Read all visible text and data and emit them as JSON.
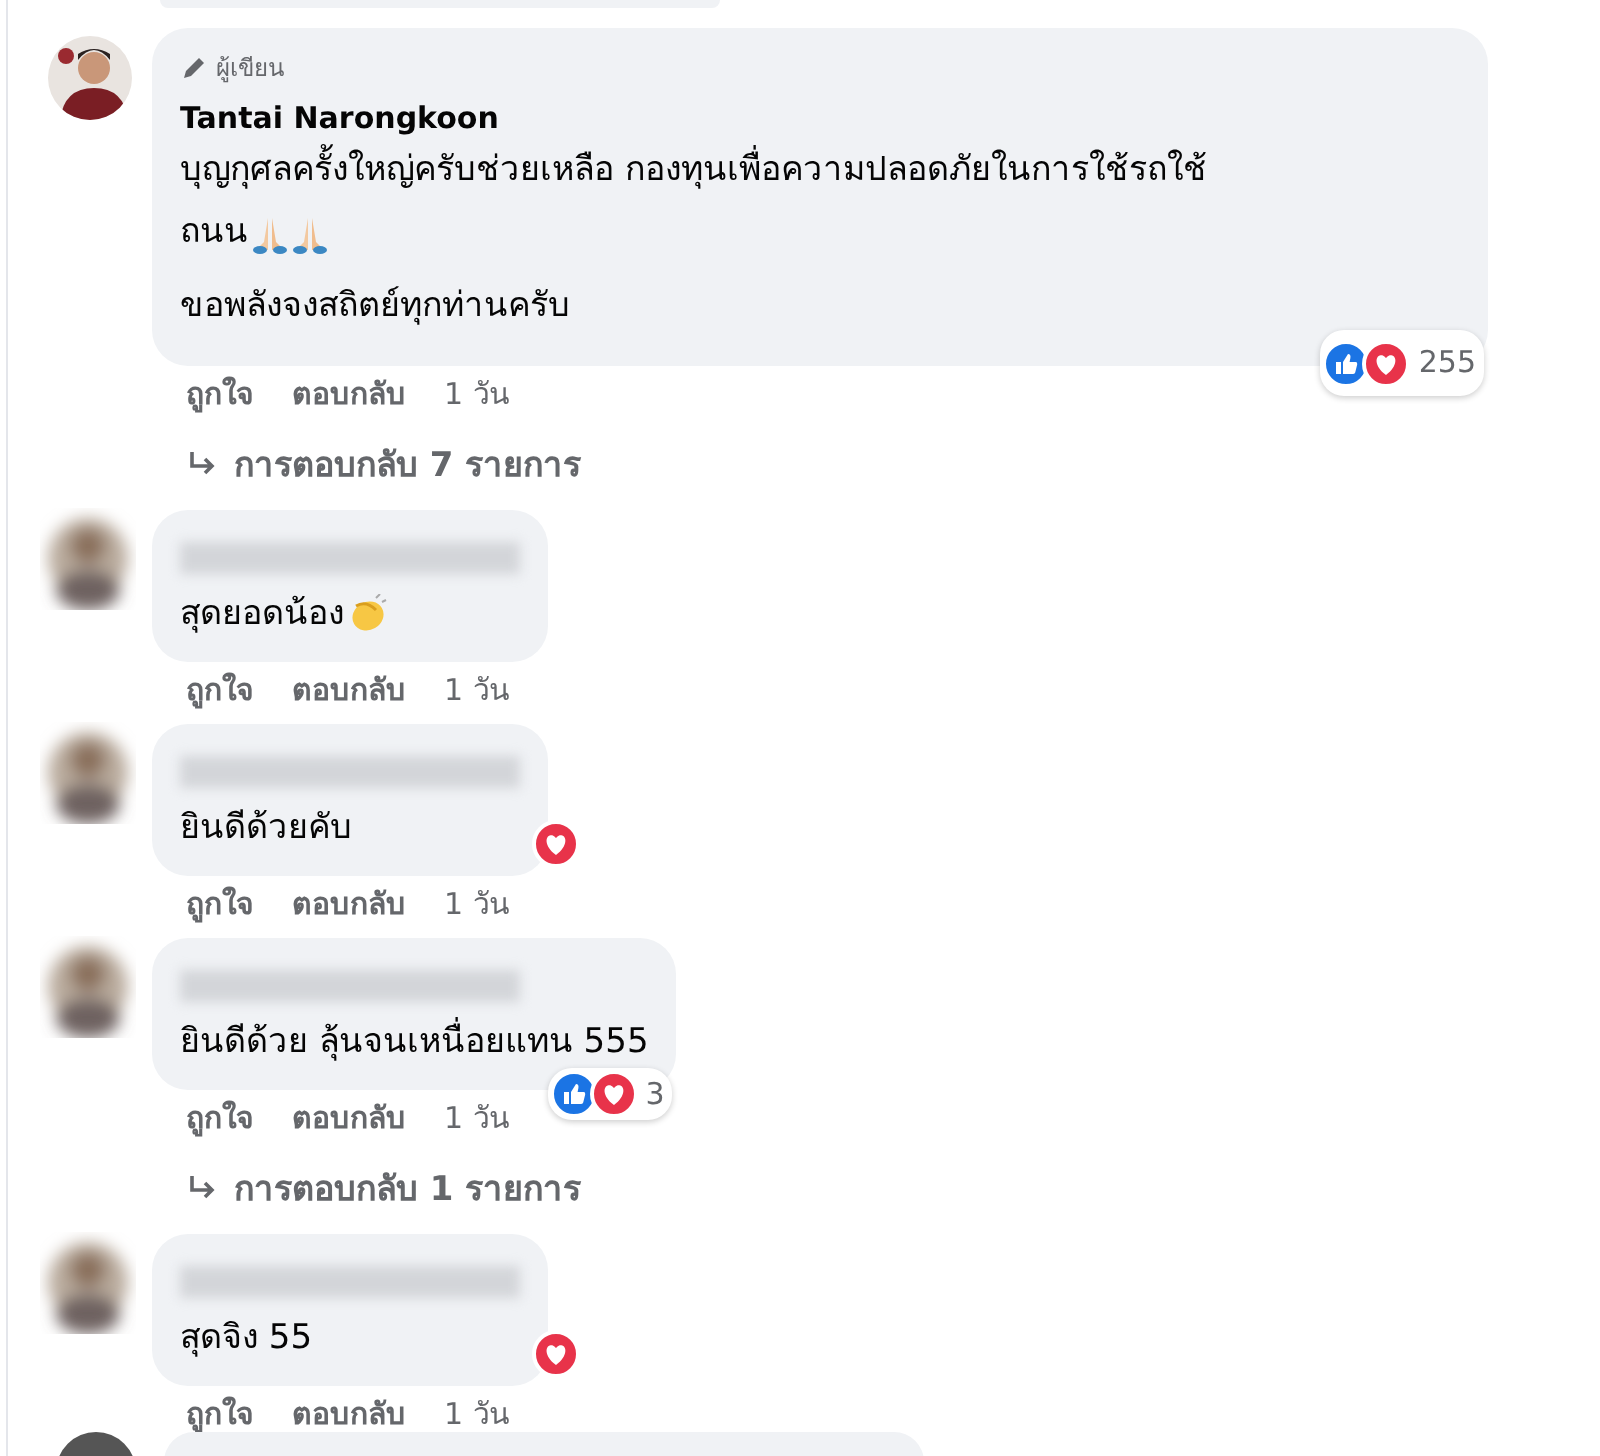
{
  "comments": [
    {
      "author": {
        "badge": "ผู้เขียน",
        "name": "Tantai Narongkoon",
        "redacted": false
      },
      "paragraphs": [
        [
          {
            "text": "บุญกุศลครั้งใหญ่ครับช่วยเหลือ กองทุนเพื่อความปลอดภัยในการใช้รถใช้"
          },
          {
            "text": "ถนน",
            "icons": [
              {
                "kind": "praying-hands"
              },
              {
                "kind": "praying-hands"
              }
            ]
          }
        ],
        [
          {
            "text": "ขอพลังจงสถิตย์ทุกท่านครับ"
          }
        ]
      ],
      "reactions": {
        "kinds": [
          {
            "kind": "like"
          },
          {
            "kind": "love"
          }
        ],
        "count": "255"
      },
      "actions": [
        "ถูกใจ",
        "ตอบกลับ",
        "1 วัน"
      ],
      "replies": "การตอบกลับ 7 รายการ"
    },
    {
      "author": {
        "redacted": true
      },
      "paragraphs": [
        [
          {
            "text": "สุดยอดน้อง",
            "icons": [
              {
                "kind": "clapping-hands"
              }
            ]
          }
        ]
      ],
      "actions": [
        "ถูกใจ",
        "ตอบกลับ",
        "1 วัน"
      ]
    },
    {
      "author": {
        "redacted": true
      },
      "paragraphs": [
        [
          {
            "text": "ยินดีด้วยคับ"
          }
        ]
      ],
      "reactions": {
        "kinds": [
          {
            "kind": "love"
          }
        ]
      },
      "actions": [
        "ถูกใจ",
        "ตอบกลับ",
        "1 วัน"
      ]
    },
    {
      "author": {
        "redacted": true
      },
      "paragraphs": [
        [
          {
            "text": "ยินดีด้วย ลุ้นจนเหนื่อยแทน 555"
          }
        ]
      ],
      "reactions": {
        "kinds": [
          {
            "kind": "like"
          },
          {
            "kind": "love"
          }
        ],
        "count": "3"
      },
      "actions": [
        "ถูกใจ",
        "ตอบกลับ",
        "1 วัน"
      ],
      "replies": "การตอบกลับ 1 รายการ"
    },
    {
      "author": {
        "redacted": true
      },
      "paragraphs": [
        [
          {
            "text": "สุดจิง 55"
          }
        ]
      ],
      "reactions": {
        "kinds": [
          {
            "kind": "love"
          }
        ]
      },
      "actions": [
        "ถูกใจ",
        "ตอบกลับ",
        "1 วัน"
      ]
    }
  ]
}
